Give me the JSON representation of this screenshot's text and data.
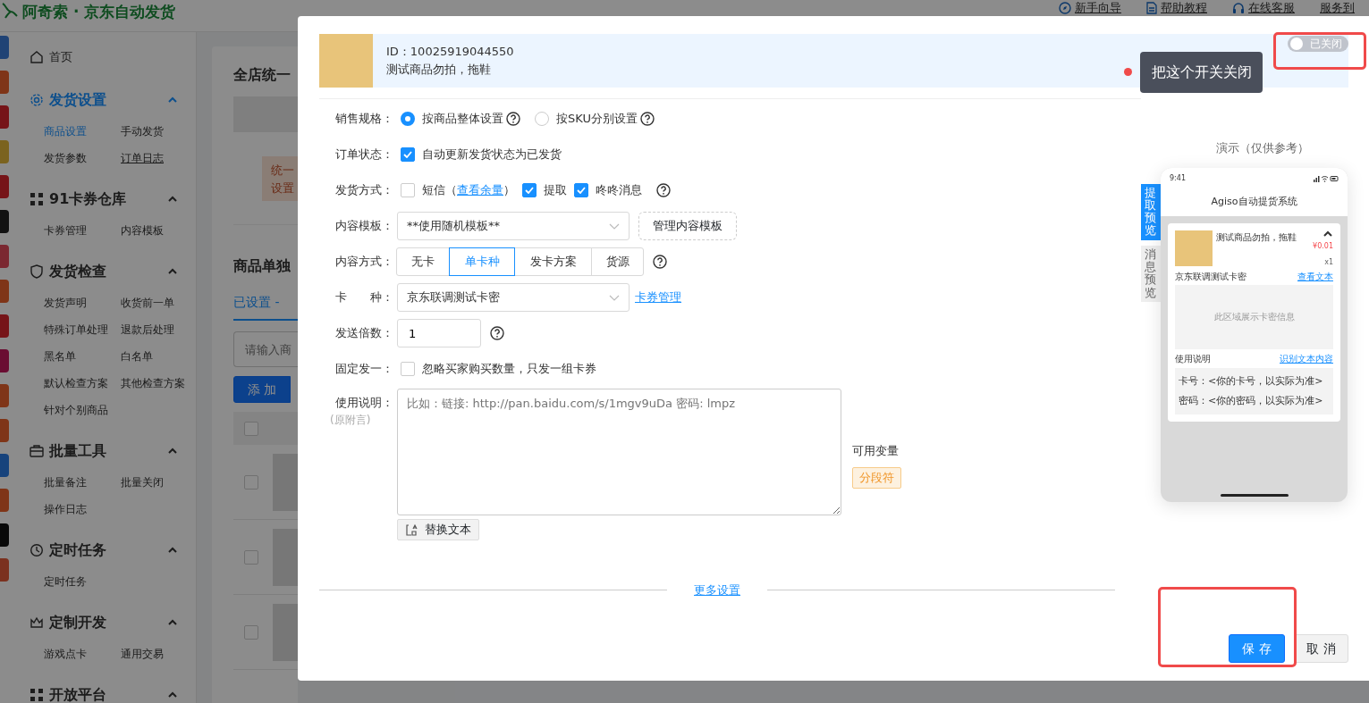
{
  "header": {
    "title": "阿奇索 · 京东自动发货",
    "links": [
      {
        "label": "新手向导"
      },
      {
        "label": "帮助教程"
      },
      {
        "label": "在线客服"
      },
      {
        "label": "服务到"
      }
    ]
  },
  "sidebar": [
    {
      "kind": "link",
      "title": "首页"
    },
    {
      "kind": "group",
      "title": "发货设置",
      "selected": true,
      "expanded": true,
      "items": [
        {
          "label": "商品设置",
          "selected": true,
          "hovered": false
        },
        {
          "label": "手动发货",
          "selected": false,
          "hovered": false
        },
        {
          "label": "发货参数",
          "selected": false,
          "hovered": false
        },
        {
          "label": "订单日志",
          "selected": false,
          "hovered": true
        }
      ]
    },
    {
      "kind": "group",
      "title": "91卡券仓库",
      "selected": false,
      "expanded": true,
      "items": [
        {
          "label": "卡券管理",
          "selected": false,
          "hovered": false
        },
        {
          "label": "内容模板",
          "selected": false,
          "hovered": false
        }
      ]
    },
    {
      "kind": "group",
      "title": "发货检查",
      "selected": false,
      "expanded": true,
      "items": [
        {
          "label": "发货声明",
          "selected": false,
          "hovered": false
        },
        {
          "label": "收货前一单",
          "selected": false,
          "hovered": false
        },
        {
          "label": "特殊订单处理",
          "selected": false,
          "hovered": false
        },
        {
          "label": "退款后处理",
          "selected": false,
          "hovered": false
        },
        {
          "label": "黑名单",
          "selected": false,
          "hovered": false
        },
        {
          "label": "白名单",
          "selected": false,
          "hovered": false
        },
        {
          "label": "默认检查方案",
          "selected": false,
          "hovered": false
        },
        {
          "label": "其他检查方案",
          "selected": false,
          "hovered": false
        },
        {
          "label": "针对个别商品",
          "selected": false,
          "hovered": false
        }
      ]
    },
    {
      "kind": "group",
      "title": "批量工具",
      "selected": false,
      "expanded": true,
      "items": [
        {
          "label": "批量备注",
          "selected": false,
          "hovered": false
        },
        {
          "label": "批量关闭",
          "selected": false,
          "hovered": false
        },
        {
          "label": "操作日志",
          "selected": false,
          "hovered": false
        }
      ]
    },
    {
      "kind": "group",
      "title": "定时任务",
      "selected": false,
      "expanded": true,
      "items": [
        {
          "label": "定时任务",
          "selected": false,
          "hovered": false
        }
      ]
    },
    {
      "kind": "group",
      "title": "定制开发",
      "selected": false,
      "expanded": true,
      "items": [
        {
          "label": "游戏点卡",
          "selected": false,
          "hovered": false
        },
        {
          "label": "通用交易",
          "selected": false,
          "hovered": false
        }
      ]
    },
    {
      "kind": "group",
      "title": "开放平台",
      "selected": false,
      "expanded": true
    }
  ],
  "main": {
    "title": "全店统一",
    "notice": [
      "统一",
      "设置"
    ],
    "section_title": "商品单独",
    "tab": "已设置 -",
    "search_placeholder": "请输入商",
    "add_button": "添 加",
    "header_checked": false,
    "rows": [
      {
        "checked": false
      },
      {
        "checked": false
      },
      {
        "checked": false
      }
    ]
  },
  "modal": {
    "product": {
      "id": "ID：10025919044550",
      "name": "测试商品勿拍，拖鞋",
      "toggle": {
        "on": false,
        "label": "已关闭"
      }
    },
    "tooltip": "把这个开关关闭",
    "form": [
      {
        "kind": "radio",
        "label": "销售规格：",
        "options": [
          {
            "label": "按商品整体设置",
            "selected": true,
            "help": true
          },
          {
            "label": "按SKU分别设置",
            "selected": false,
            "help": true
          }
        ]
      },
      {
        "kind": "checks",
        "label": "订单状态：",
        "options": [
          {
            "label": "自动更新发货状态为已发货",
            "checked": true
          }
        ]
      },
      {
        "kind": "checks",
        "label": "发货方式：",
        "help": true,
        "options": [
          {
            "label": "短信（",
            "link": "查看余量",
            "suffix": "）",
            "checked": false
          },
          {
            "label": "提取",
            "checked": true
          },
          {
            "label": "咚咚消息",
            "checked": true
          }
        ]
      },
      {
        "kind": "select",
        "label": "内容模板：",
        "value": "**使用随机模板**",
        "button": "管理内容模板"
      },
      {
        "kind": "segmented",
        "label": "内容方式：",
        "help": true,
        "options": [
          {
            "label": "无卡",
            "selected": false
          },
          {
            "label": "单卡种",
            "selected": true
          },
          {
            "label": "发卡方案",
            "selected": false
          },
          {
            "label": "货源",
            "selected": false
          }
        ]
      },
      {
        "kind": "select",
        "label": "卡　　种：",
        "value": "京东联调测试卡密",
        "link": "卡券管理"
      },
      {
        "kind": "number",
        "label": "发送倍数：",
        "value": "1",
        "help": true
      },
      {
        "kind": "checks",
        "label": "固定发一：",
        "options": [
          {
            "label": "忽略买家购买数量，只发一组卡券",
            "checked": false
          }
        ]
      },
      {
        "kind": "textarea",
        "label": "使用说明：",
        "sublabel": "(原附言)",
        "placeholder": "比如：链接: http://pan.baidu.com/s/1mgv9uDa 密码: lmpz",
        "button": "替换文本",
        "variables_title": "可用变量",
        "variables": [
          "分段符"
        ]
      }
    ],
    "more_settings": "更多设置",
    "preview": {
      "title": "演示（仅供参考）",
      "tabs": [
        {
          "label": "提取预览",
          "selected": true
        },
        {
          "label": "消息预览",
          "selected": false
        }
      ],
      "phone": {
        "time": "9:41",
        "app_title": "Agiso自动提货系统",
        "product_name": "测试商品勿拍，拖鞋",
        "price": "¥0.01",
        "qty": "x1",
        "card_name": "京东联调测试卡密",
        "view_text": "查看文本",
        "card_area": "此区域展示卡密信息",
        "usage_title": "使用说明",
        "recognize": "识别文本内容",
        "usage_text": "卡号：<你的卡号，以实际为准>密码：<你的密码，以实际为准>"
      }
    },
    "footer": {
      "save": "保 存",
      "cancel": "取 消"
    }
  }
}
